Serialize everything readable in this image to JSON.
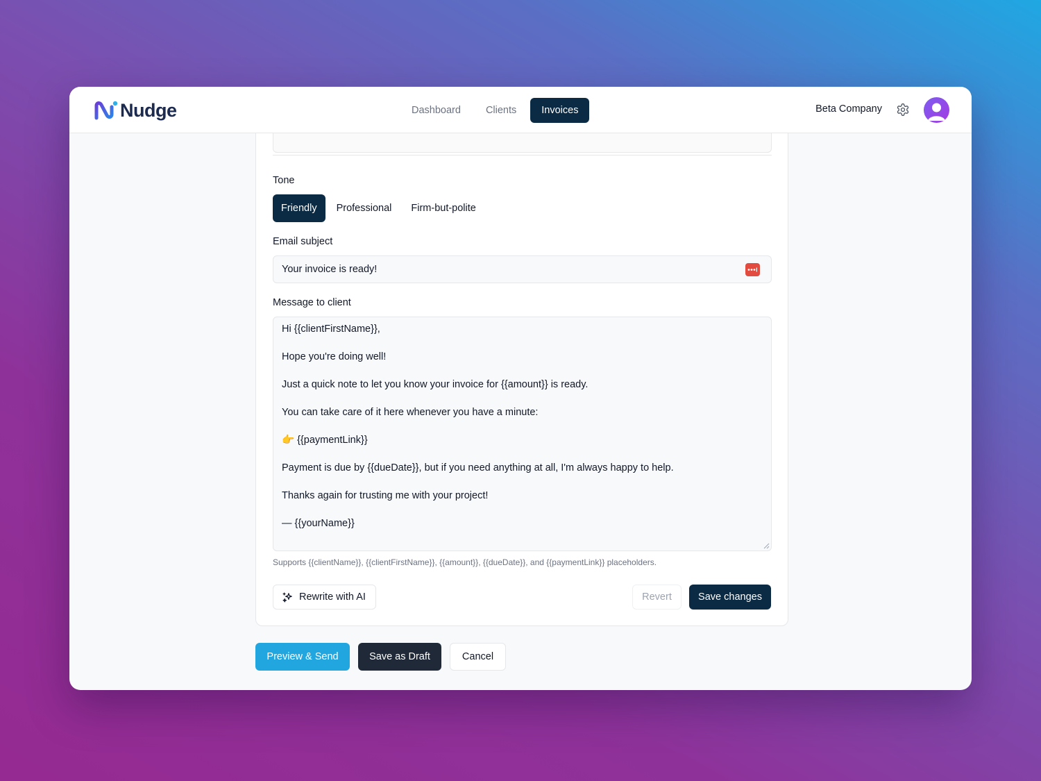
{
  "brand": {
    "name": "Nudge"
  },
  "nav": [
    {
      "label": "Dashboard",
      "active": false
    },
    {
      "label": "Clients",
      "active": false
    },
    {
      "label": "Invoices",
      "active": true
    }
  ],
  "header": {
    "company": "Beta Company",
    "settings_icon": "gear-icon",
    "avatar_icon": "user-avatar"
  },
  "form": {
    "tone_label": "Tone",
    "tones": [
      {
        "label": "Friendly",
        "active": true
      },
      {
        "label": "Professional",
        "active": false
      },
      {
        "label": "Firm-but-polite",
        "active": false
      }
    ],
    "subject_label": "Email subject",
    "subject_value": "Your invoice is ready!",
    "message_label": "Message to client",
    "message_lines": [
      "Hi {{clientFirstName}},",
      "Hope you're doing well!",
      "Just a quick note to let you know your invoice for {{amount}} is ready.",
      "You can take care of it here whenever you have a minute:",
      "👉 {{paymentLink}}",
      "Payment is due by {{dueDate}}, but if you need anything at all, I'm always happy to help.",
      "Thanks again for trusting me with your project!",
      "— {{yourName}}"
    ],
    "hint": "Supports {{clientName}}, {{clientFirstName}}, {{amount}}, {{dueDate}}, and {{paymentLink}} placeholders.",
    "rewrite_label": "Rewrite with AI",
    "revert_label": "Revert",
    "save_label": "Save changes"
  },
  "actions": {
    "preview_label": "Preview & Send",
    "draft_label": "Save as Draft",
    "cancel_label": "Cancel"
  },
  "colors": {
    "primary": "#0b2a44",
    "accent": "#22a6e0",
    "draft": "#1f2937",
    "password_manager": "#e24b3f"
  }
}
